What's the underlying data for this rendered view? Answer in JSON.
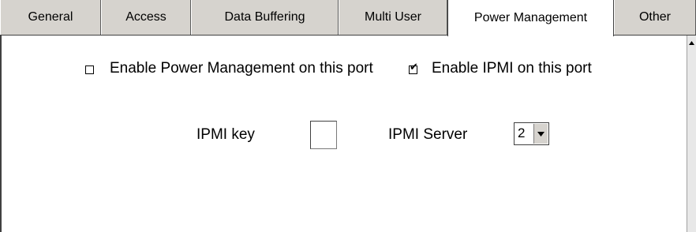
{
  "tabs": [
    {
      "label": "General"
    },
    {
      "label": "Access"
    },
    {
      "label": "Data Buffering"
    },
    {
      "label": "Multi User"
    },
    {
      "label": "Power Management",
      "active": true
    },
    {
      "label": "Other"
    }
  ],
  "power_panel": {
    "enable_power_mgmt": {
      "label": "Enable Power Management on this port",
      "checked": false
    },
    "enable_ipmi": {
      "label": "Enable IPMI on this port",
      "checked": true
    },
    "ipmi_key": {
      "label": "IPMI key",
      "value": ""
    },
    "ipmi_server": {
      "label": "IPMI Server",
      "selected": "2"
    }
  },
  "icons": {
    "checkmark": "✔",
    "dropdown_arrow": "chevron-down-icon",
    "scroll_up_arrow": "arrow-up-icon"
  },
  "colors": {
    "tab_background": "#d6d3ce",
    "panel_background": "#ffffff",
    "border_dark": "#404040"
  }
}
